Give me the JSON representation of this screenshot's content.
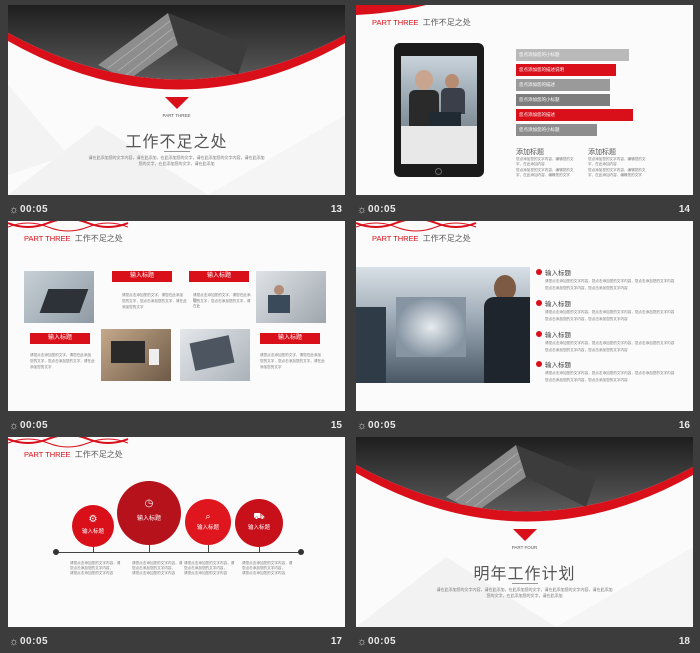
{
  "slides": [
    {
      "number": "13",
      "time": "00:05",
      "tag": "PART THREE",
      "title": "工作不足之处",
      "subtitle_line1": "请在此添加您的文字内容，请在此添加，在此添加您的文字，请在此添加您的文字内容，请在此添加",
      "subtitle_line2": "您的文字，在此添加您的文字，请在此添加"
    },
    {
      "number": "14",
      "time": "00:05",
      "header_part": "PART THREE",
      "header_title": "工作不足之处",
      "bars": [
        {
          "label": "您点添加您的小标题",
          "color": "#b9b9b9",
          "value": 0.87
        },
        {
          "label": "您点添加您的描述说明",
          "color": "#d90f1a",
          "value": 0.77
        },
        {
          "label": "您点添加您的描述",
          "color": "#9a9a9a",
          "value": 0.72
        },
        {
          "label": "您点添加您的小标题",
          "color": "#7d7d7d",
          "value": 0.72
        },
        {
          "label": "您点添加您的描述",
          "color": "#d90f1a",
          "value": 0.9
        },
        {
          "label": "您点添加您的小标题",
          "color": "#8d8d8d",
          "value": 0.62
        }
      ],
      "col1_title": "添加标题",
      "col1_text": [
        "您点添加您的文字内容，编辑您的文字，在此添加内容",
        "您点添加您的文字内容，编辑您的文字，在此添加内容，编辑您的文字"
      ],
      "col2_title": "添加标题",
      "col2_text": [
        "您点添加您的文字内容，编辑您的文字，在此添加内容",
        "您点添加您的文字内容，编辑您的文字，在此添加内容，编辑您的文字"
      ]
    },
    {
      "number": "15",
      "time": "00:05",
      "header_part": "PART THREE",
      "header_title": "工作不足之处",
      "labels": [
        "输入标题",
        "输入标题",
        "输入标题",
        "输入标题"
      ],
      "text_a": [
        "请您点击添加您的文字，请您在此添加",
        "您的文字，您点击添加您的文字，请在此",
        "添加您的文字"
      ],
      "text_b": [
        "请您点击添加您的文字，请您在此添加",
        "您的文字，您点击添加您的文字，请在此",
        "添加您的文字"
      ]
    },
    {
      "number": "16",
      "time": "00:05",
      "header_part": "PART THREE",
      "header_title": "工作不足之处",
      "items": [
        {
          "title": "输入标题",
          "text": [
            "请您点击添加您的文字内容，您点击添加您的文字内容，您点击添加您的文字内容",
            "您点击添加您的文字内容，您点击添加您的文字内容"
          ]
        },
        {
          "title": "输入标题",
          "text": [
            "请您点击添加您的文字内容，您点击添加您的文字内容，您点击添加您的文字内容",
            "您点击添加您的文字内容，您点击添加您的文字内容"
          ]
        },
        {
          "title": "输入标题",
          "text": [
            "请您点击添加您的文字内容，您点击添加您的文字内容，您点击添加您的文字内容",
            "您点击添加您的文字内容，您点击添加您的文字内容"
          ]
        },
        {
          "title": "输入标题",
          "text": [
            "请您点击添加您的文字内容，您点击添加您的文字内容，您点击添加您的文字内容",
            "您点击添加您的文字内容，您点击添加您的文字内容"
          ]
        }
      ]
    },
    {
      "number": "17",
      "time": "00:05",
      "header_part": "PART THREE",
      "header_title": "工作不足之处",
      "circles": [
        "输入标题",
        "输入标题",
        "输入标题",
        "输入标题"
      ],
      "texts": [
        [
          "请您点击添加您的文字内容，请",
          "您点击添加您的文字内容，",
          "请您点击添加您的文字内容"
        ],
        [
          "请您点击添加您的文字内容，请",
          "您点击添加您的文字内容，",
          "请您点击添加您的文字内容"
        ],
        [
          "请您点击添加您的文字内容，请",
          "您点击添加您的文字内容，",
          "请您点击添加您的文字内容"
        ],
        [
          "请您点击添加您的文字内容，请",
          "您点击添加您的文字内容，",
          "请您点击添加您的文字内容"
        ]
      ]
    },
    {
      "number": "18",
      "time": "00:05",
      "tag": "PART FOUR",
      "title": "明年工作计划",
      "subtitle_line1": "请在此添加您的文字内容，请在此添加，在此添加您的文字，请在此添加您的文字内容，请在此添加",
      "subtitle_line2": "您的文字，在此添加您的文字，请在此添加"
    }
  ],
  "icons": {
    "clock": "clock-icon",
    "gear": "gear-icon",
    "search": "search-icon",
    "cart": "cart-icon"
  }
}
